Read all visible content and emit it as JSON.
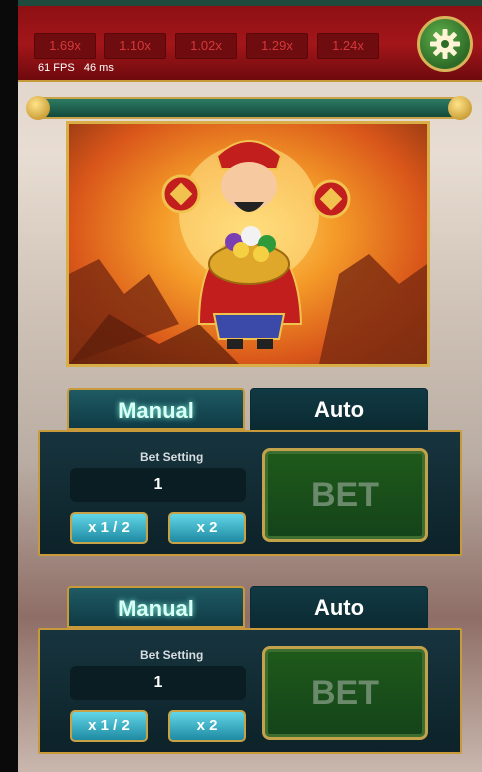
{
  "top_bar": {
    "multipliers": [
      "1.69x",
      "1.10x",
      "1.02x",
      "1.29x",
      "1.24x"
    ],
    "fps_text": "61 FPS",
    "ms_text": "46 ms",
    "settings_icon": "gear-icon"
  },
  "panels": [
    {
      "tabs": {
        "manual": "Manual",
        "auto": "Auto",
        "active": "Manual"
      },
      "bet_setting_label": "Bet Setting",
      "amount": "1",
      "half_label": "x 1 / 2",
      "double_label": "x 2",
      "bet_label": "BET"
    },
    {
      "tabs": {
        "manual": "Manual",
        "auto": "Auto",
        "active": "Manual"
      },
      "bet_setting_label": "Bet Setting",
      "amount": "1",
      "half_label": "x 1 / 2",
      "double_label": "x 2",
      "bet_label": "BET"
    }
  ],
  "colors": {
    "topbar_red": "#a3161a",
    "gear_green": "#2d6b27",
    "tab_teal": "#1f5a63",
    "gold_border": "#c89a3a",
    "bet_green": "#1f5a1a"
  }
}
